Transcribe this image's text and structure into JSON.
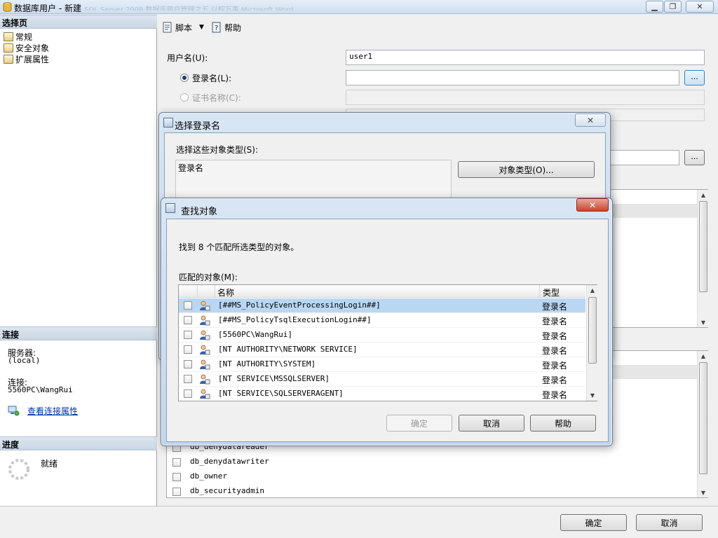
{
  "window": {
    "title": "数据库用户 - 新建",
    "background_caption": "SQL Server 2008 数据库用户管理之五 以权万事 Microsoft Word"
  },
  "left_panel": {
    "select_page_header": "选择页",
    "pages": [
      {
        "label": "常规",
        "icon": "wrench-page-icon"
      },
      {
        "label": "安全对象",
        "icon": "wrench-page-icon"
      },
      {
        "label": "扩展属性",
        "icon": "wrench-page-icon"
      }
    ],
    "connection_header": "连接",
    "server_label": "服务器:",
    "server_value": "(local)",
    "connection_label": "连接:",
    "connection_value": "5560PC\\WangRui",
    "view_connection_link": "查看连接属性",
    "progress_header": "进度",
    "progress_status": "就绪"
  },
  "toolbar": {
    "script_label": "脚本",
    "help_label": "帮助"
  },
  "general": {
    "username_label": "用户名(U):",
    "username_value": "user1",
    "login_name_label": "登录名(L):",
    "login_name_value": "",
    "login_browse": "...",
    "cert_name_label": "证书名称(C):",
    "schema_browse": "..."
  },
  "roles_list": {
    "items": [
      "db_denydatareader",
      "db_denydatawriter",
      "db_owner",
      "db_securityadmin"
    ]
  },
  "footer": {
    "ok_label": "确定",
    "cancel_label": "取消"
  },
  "select_login_dialog": {
    "title": "选择登录名",
    "object_types_label": "选择这些对象类型(S):",
    "object_types_value": "登录名",
    "object_types_button": "对象类型(O)..."
  },
  "find_objects_dialog": {
    "title": "查找对象",
    "found_text": "找到 8 个匹配所选类型的对象。",
    "matched_label": "匹配的对象(M):",
    "columns": {
      "name": "名称",
      "type": "类型"
    },
    "rows": [
      {
        "name": "[##MS_PolicyEventProcessingLogin##]",
        "type": "登录名",
        "selected": true
      },
      {
        "name": "[##MS_PolicyTsqlExecutionLogin##]",
        "type": "登录名",
        "selected": false
      },
      {
        "name": "[5560PC\\WangRui]",
        "type": "登录名",
        "selected": false
      },
      {
        "name": "[NT AUTHORITY\\NETWORK SERVICE]",
        "type": "登录名",
        "selected": false
      },
      {
        "name": "[NT AUTHORITY\\SYSTEM]",
        "type": "登录名",
        "selected": false
      },
      {
        "name": "[NT SERVICE\\MSSQLSERVER]",
        "type": "登录名",
        "selected": false
      },
      {
        "name": "[NT SERVICE\\SQLSERVERAGENT]",
        "type": "登录名",
        "selected": false
      }
    ],
    "ok_label": "确定",
    "cancel_label": "取消",
    "help_label": "帮助"
  },
  "colors": {
    "selection": "#b9d7f3",
    "link": "#0033aa",
    "header_gradient": "#c9d6e4"
  }
}
